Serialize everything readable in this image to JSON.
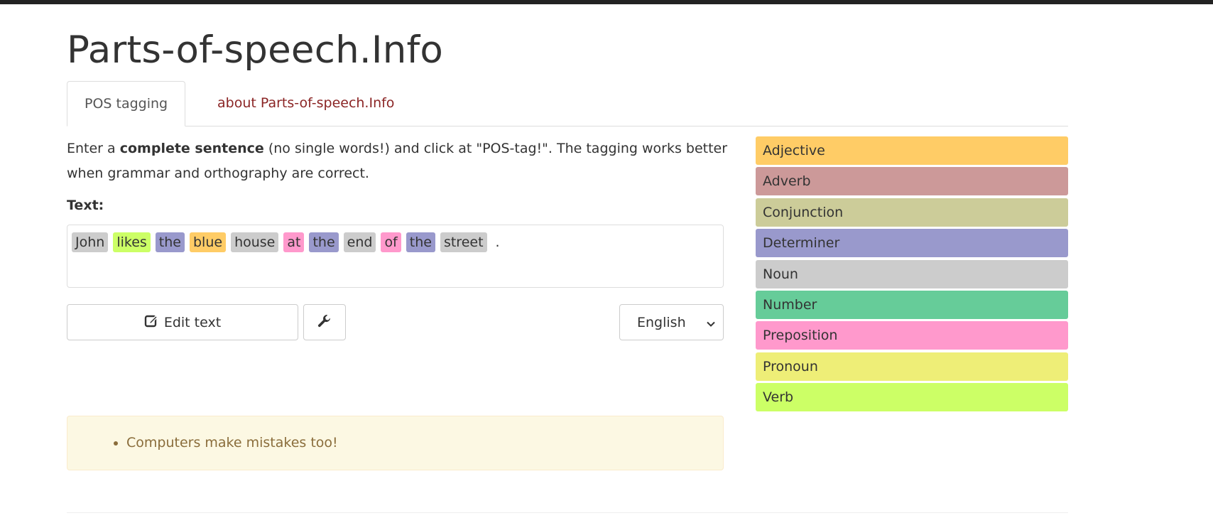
{
  "site": {
    "title": "Parts-of-speech.Info"
  },
  "tabs": [
    {
      "label": "POS tagging",
      "active": true
    },
    {
      "label": "about Parts-of-speech.Info",
      "active": false
    }
  ],
  "intro": {
    "before": "Enter a ",
    "bold": "complete sentence",
    "after": " (no single words!) and click at \"POS-tag!\". The tagging works better when grammar and orthography are correct."
  },
  "text_label": "Text:",
  "tagged_tokens": [
    {
      "word": "John",
      "pos": "Noun"
    },
    {
      "word": "likes",
      "pos": "Verb"
    },
    {
      "word": "the",
      "pos": "Determiner"
    },
    {
      "word": "blue",
      "pos": "Adjective"
    },
    {
      "word": "house",
      "pos": "Noun"
    },
    {
      "word": "at",
      "pos": "Preposition"
    },
    {
      "word": "the",
      "pos": "Determiner"
    },
    {
      "word": "end",
      "pos": "Noun"
    },
    {
      "word": "of",
      "pos": "Preposition"
    },
    {
      "word": "the",
      "pos": "Determiner"
    },
    {
      "word": "street",
      "pos": "Noun"
    },
    {
      "word": ".",
      "pos": null
    }
  ],
  "buttons": {
    "edit_label": "Edit text",
    "edit_icon": "edit-icon",
    "tools_icon": "wrench-icon"
  },
  "language_select": {
    "selected": "English",
    "icon": "chevron-down-icon"
  },
  "alert": {
    "items": [
      "Computers make mistakes too!"
    ]
  },
  "legend": [
    {
      "label": "Adjective",
      "color": "#ffcc66"
    },
    {
      "label": "Adverb",
      "color": "#cc9999"
    },
    {
      "label": "Conjunction",
      "color": "#cccc99"
    },
    {
      "label": "Determiner",
      "color": "#9999cc"
    },
    {
      "label": "Noun",
      "color": "#cccccc"
    },
    {
      "label": "Number",
      "color": "#66cc99"
    },
    {
      "label": "Preposition",
      "color": "#ff99cc"
    },
    {
      "label": "Pronoun",
      "color": "#eeee77"
    },
    {
      "label": "Verb",
      "color": "#ccff66"
    }
  ]
}
